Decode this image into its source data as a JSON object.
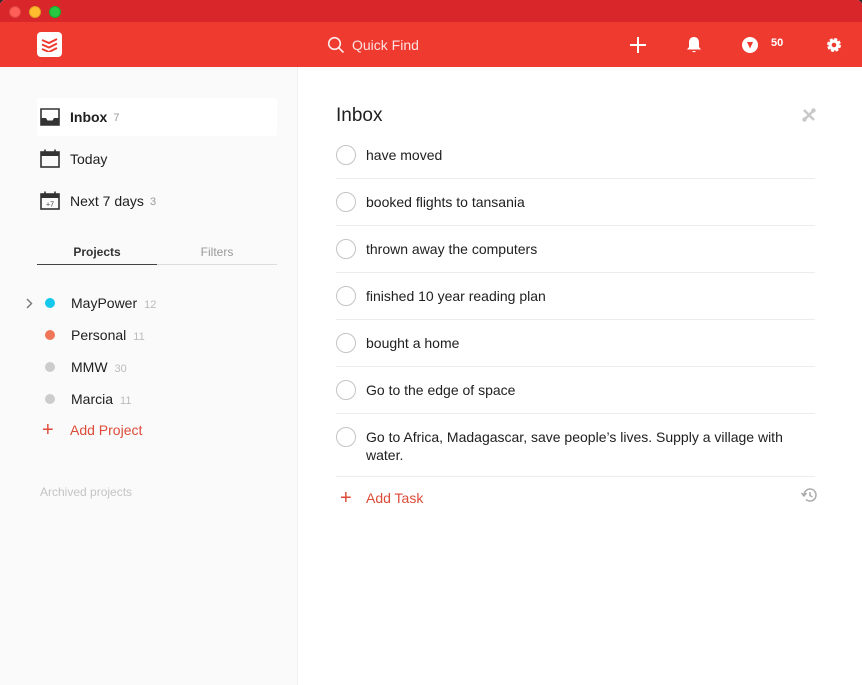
{
  "colors": {
    "brand": "#ef3a2f",
    "accent": "#dd4b39"
  },
  "topbar": {
    "search_placeholder": "Quick Find",
    "karma_count": "50"
  },
  "sidebar": {
    "nav": [
      {
        "label": "Inbox",
        "count": "7"
      },
      {
        "label": "Today",
        "count": ""
      },
      {
        "label": "Next 7 days",
        "count": "3"
      }
    ],
    "tabs": [
      "Projects",
      "Filters"
    ],
    "projects": [
      {
        "label": "MayPower",
        "count": "12",
        "color": "#14c8ec"
      },
      {
        "label": "Personal",
        "count": "11",
        "color": "#f0765a"
      },
      {
        "label": "MMW",
        "count": "30",
        "color": "#cccccc"
      },
      {
        "label": "Marcia",
        "count": "11",
        "color": "#cccccc"
      }
    ],
    "add_project": "Add Project",
    "archived": "Archived projects"
  },
  "main": {
    "title": "Inbox",
    "tasks": [
      "have moved",
      "booked flights to tansania",
      "thrown away the computers",
      "finished 10 year reading plan",
      "bought a home",
      "Go to the edge of space",
      "Go to Africa, Madagascar, save people’s lives. Supply a village with water."
    ],
    "add_task": "Add Task"
  }
}
